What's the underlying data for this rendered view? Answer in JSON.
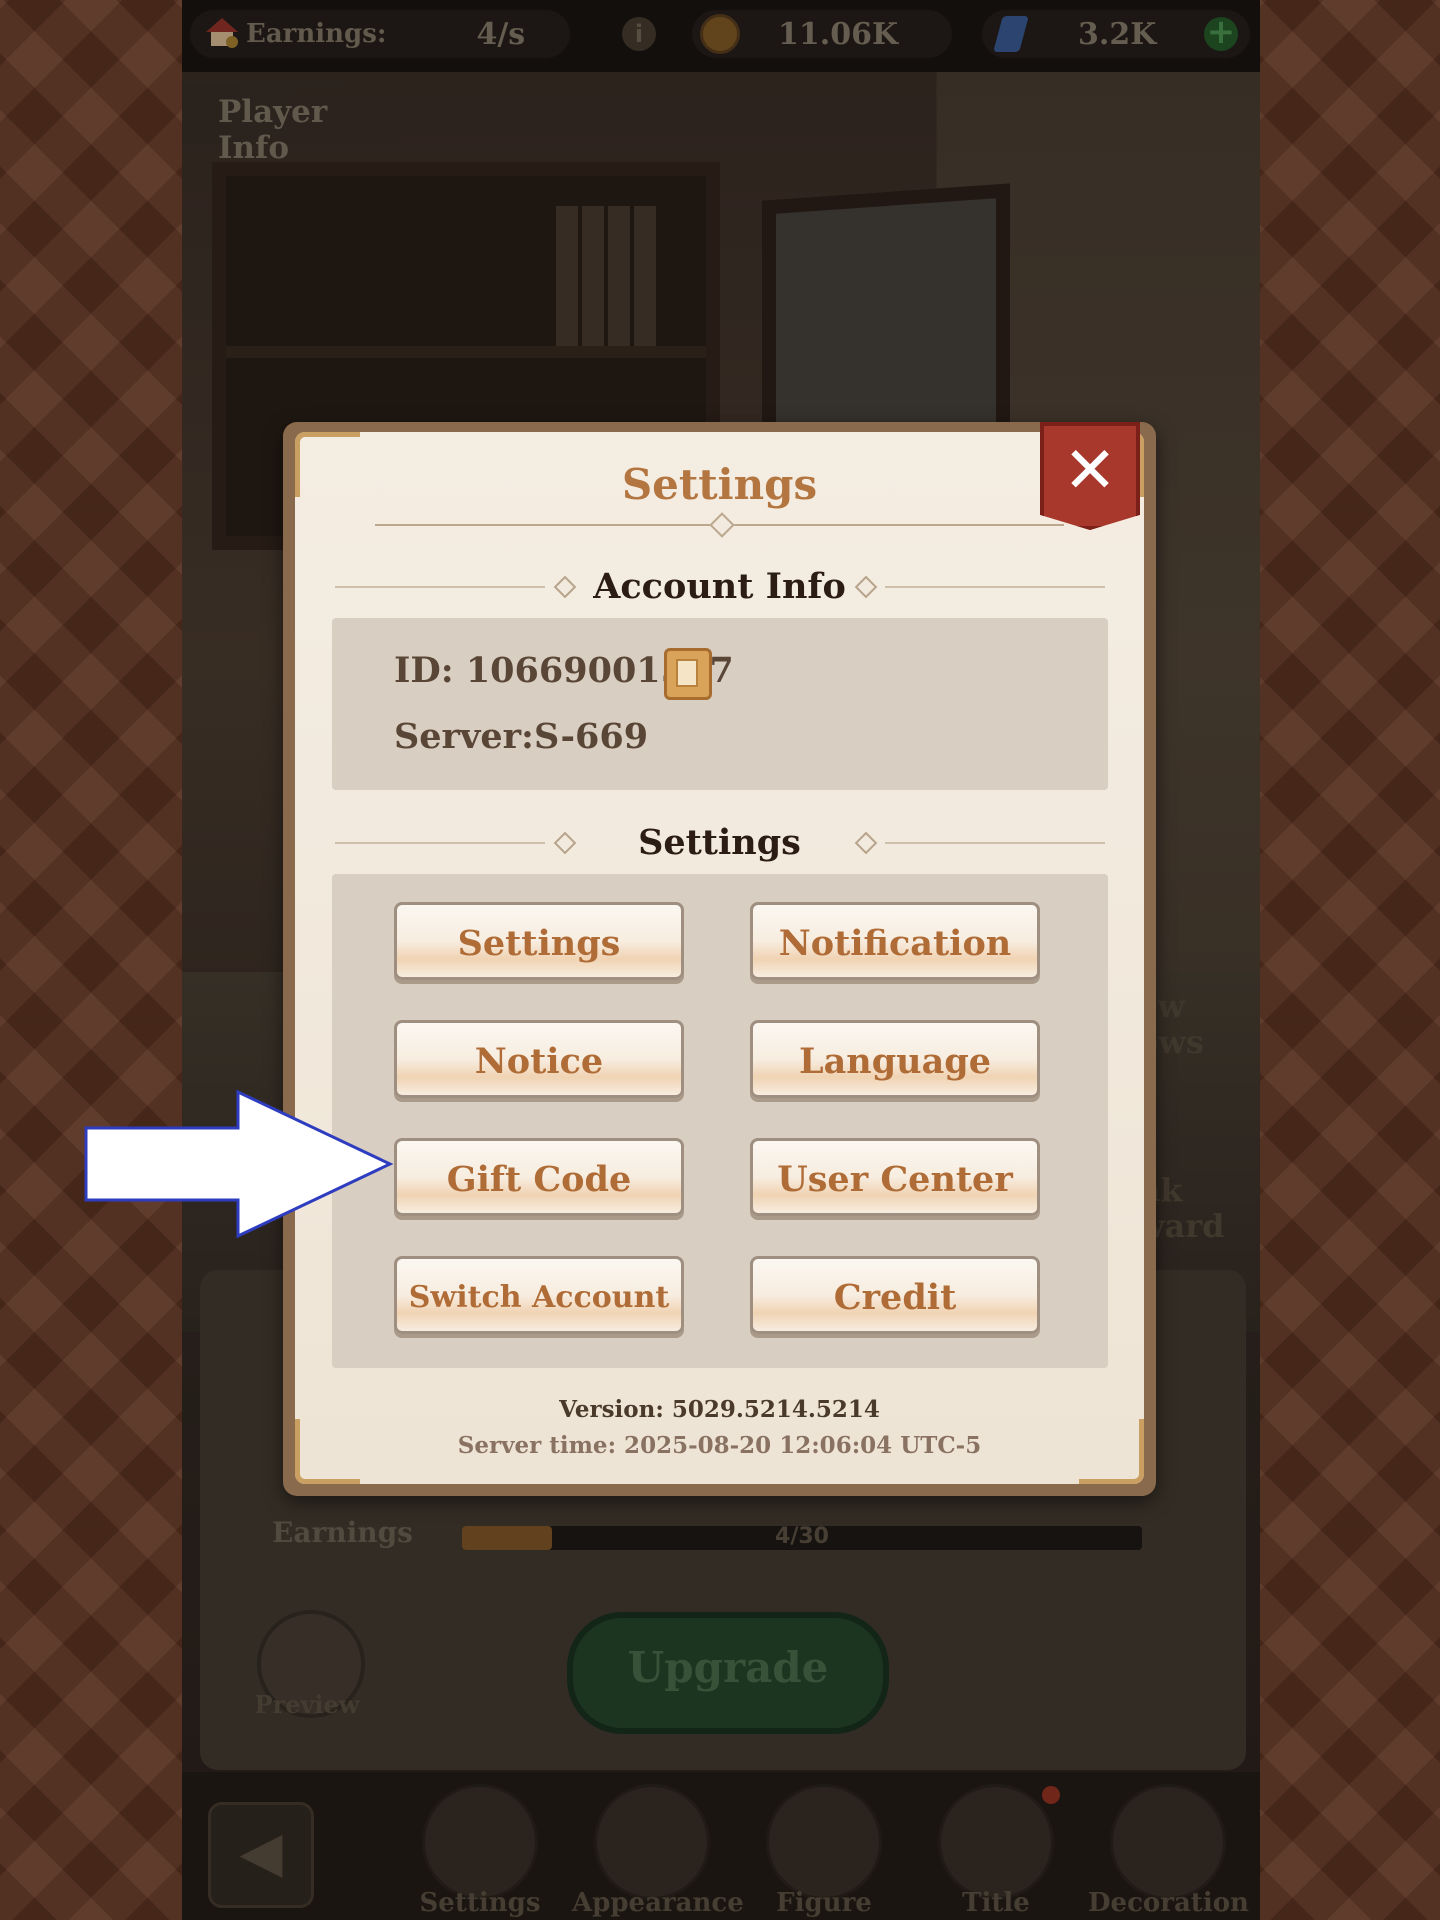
{
  "topbar": {
    "earnings_label": "Earnings:",
    "earnings_value": "4/s",
    "coins_value": "11.06K",
    "gems_value": "3.2K",
    "icons": [
      "house-icon",
      "info-icon",
      "coin-icon",
      "gem-icon",
      "plus-icon"
    ]
  },
  "background": {
    "player_info": "Player Info",
    "side_label_1": "ew\nows",
    "side_label_2": "nk\nward",
    "earnings_label": "Earnings",
    "earnings_progress_text": "4/30",
    "earnings_progress_fraction": 0.133,
    "preview_label": "Preview",
    "upgrade_label": "Upgrade"
  },
  "bottom_nav": {
    "items": [
      {
        "label": "Settings"
      },
      {
        "label": "Appearance"
      },
      {
        "label": "Figure"
      },
      {
        "label": "Title"
      },
      {
        "label": "Decoration"
      }
    ]
  },
  "dialog": {
    "title": "Settings",
    "account_section": "Account Info",
    "id_text": "ID: 10669001517",
    "server_text": "Server:S-669",
    "settings_section": "Settings",
    "buttons": [
      {
        "label": "Settings"
      },
      {
        "label": "Notification"
      },
      {
        "label": "Notice"
      },
      {
        "label": "Language"
      },
      {
        "label": "Gift Code"
      },
      {
        "label": "User Center"
      },
      {
        "label": "Switch Account"
      },
      {
        "label": "Credit"
      }
    ],
    "version": "Version: 5029.5214.5214",
    "server_time": "Server time: 2025-08-20 12:06:04 UTC-5"
  },
  "colors": {
    "accent_text": "#b06c36",
    "close_red": "#a8382b",
    "arrow_border": "#2e3cbf"
  }
}
